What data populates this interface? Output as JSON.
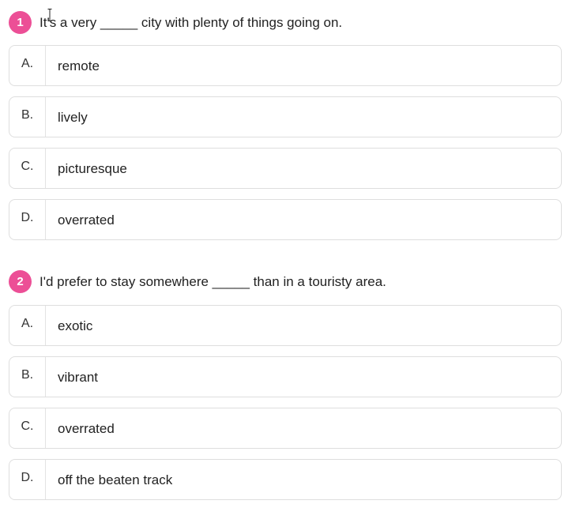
{
  "questions": [
    {
      "number": "1",
      "text": "It's a very _____ city with plenty of things going on.",
      "options": [
        {
          "letter": "A.",
          "text": "remote"
        },
        {
          "letter": "B.",
          "text": "lively"
        },
        {
          "letter": "C.",
          "text": "picturesque"
        },
        {
          "letter": "D.",
          "text": "overrated"
        }
      ]
    },
    {
      "number": "2",
      "text": "I'd prefer to stay somewhere _____ than in a touristy area.",
      "options": [
        {
          "letter": "A.",
          "text": "exotic"
        },
        {
          "letter": "B.",
          "text": "vibrant"
        },
        {
          "letter": "C.",
          "text": "overrated"
        },
        {
          "letter": "D.",
          "text": "off the beaten track"
        }
      ]
    }
  ],
  "colors": {
    "badge": "#ec4f96",
    "border": "#dedede"
  },
  "icons": {
    "cursor": "text-cursor-icon"
  }
}
